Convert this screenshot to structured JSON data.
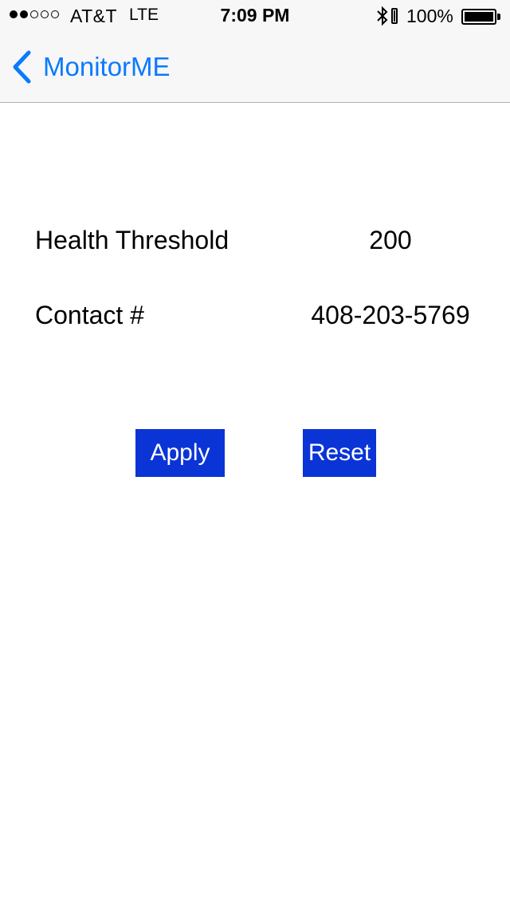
{
  "status_bar": {
    "signal_strength": 2,
    "signal_max": 5,
    "carrier": "AT&T",
    "network": "LTE",
    "time": "7:09 PM",
    "battery_percent": "100%",
    "battery_level": 1.0,
    "icons": [
      "bluetooth-icon",
      "battery-icon"
    ]
  },
  "nav": {
    "back_label": "MonitorME",
    "back_icon": "chevron-left-icon",
    "accent_color": "#0a7aff"
  },
  "settings": {
    "health_threshold": {
      "label": "Health Threshold",
      "value": "200"
    },
    "contact": {
      "label": "Contact #",
      "value": "408-203-5769"
    }
  },
  "buttons": {
    "apply_label": "Apply",
    "reset_label": "Reset",
    "color": "#0a34d6"
  }
}
